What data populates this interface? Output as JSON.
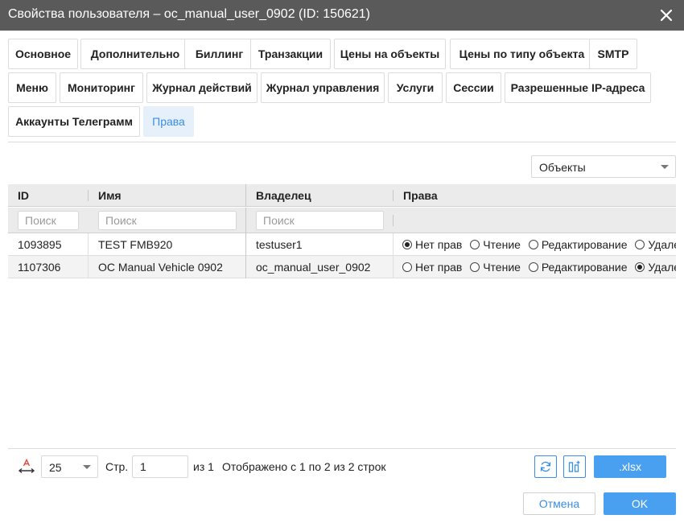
{
  "window": {
    "title": "Свойства пользователя – oc_manual_user_0902 (ID: 150621)"
  },
  "tabs": [
    {
      "label": "Основное"
    },
    {
      "label": "Дополнительно"
    },
    {
      "label": "Биллинг"
    },
    {
      "label": "Транзакции"
    },
    {
      "label": "Цены на объекты"
    },
    {
      "label": "Цены по типу объекта"
    },
    {
      "label": "SMTP"
    },
    {
      "label": "Меню"
    },
    {
      "label": "Мониторинг"
    },
    {
      "label": "Журнал действий"
    },
    {
      "label": "Журнал управления"
    },
    {
      "label": "Услуги"
    },
    {
      "label": "Сессии"
    },
    {
      "label": "Разрешенные IP-адреса"
    },
    {
      "label": "Аккаунты Телеграмм"
    },
    {
      "label": "Права",
      "active": true
    }
  ],
  "object_type_select": {
    "value": "Объекты"
  },
  "table": {
    "columns": {
      "id": "ID",
      "name": "Имя",
      "owner": "Владелец",
      "rights": "Права"
    },
    "filter_placeholder": "Поиск",
    "rights_options": [
      "Нет прав",
      "Чтение",
      "Редактирование",
      "Удале"
    ],
    "rows": [
      {
        "id": "1093895",
        "name": "TEST FMB920",
        "owner": "testuser1",
        "selected": 0
      },
      {
        "id": "1107306",
        "name": "OC Manual Vehicle 0902",
        "owner": "oc_manual_user_0902",
        "selected": 3
      }
    ]
  },
  "pager": {
    "page_size": "25",
    "page_label": "Стр.",
    "page": "1",
    "of_label": "из 1",
    "summary": "Отображено с 1 по 2 из 2 строк",
    "export_label": ".xlsx"
  },
  "footer": {
    "cancel_label": "Отмена",
    "ok_label": "OK"
  },
  "colors": {
    "accent": "#3a8ee6",
    "primary_button": "#4aa0f0",
    "titlebar": "#5a5a5a"
  }
}
